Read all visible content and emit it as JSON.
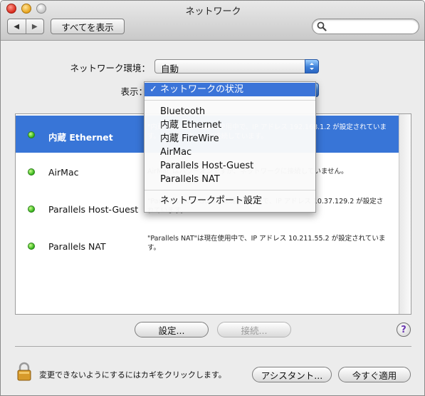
{
  "window": {
    "title": "ネットワーク"
  },
  "toolbar": {
    "back_label": "◀",
    "forward_label": "▶",
    "show_all_label": "すべてを表示",
    "search_value": ""
  },
  "location": {
    "label": "ネットワーク環境：",
    "value": "自動"
  },
  "show": {
    "label": "表示："
  },
  "dropdown": {
    "selected_check": "✓",
    "items": [
      {
        "label": "ネットワークの状況"
      },
      {
        "label": "Bluetooth"
      },
      {
        "label": "内蔵 Ethernet"
      },
      {
        "label": "内蔵 FireWire"
      },
      {
        "label": "AirMac"
      },
      {
        "label": "Parallels Host-Guest"
      },
      {
        "label": "Parallels NAT"
      },
      {
        "label": "ネットワークポート設定"
      }
    ]
  },
  "interfaces": [
    {
      "name": "内蔵 Ethernet",
      "status": "\"内蔵 Ethernet\"は現在使用中で、IP アドレス 192.168.1.2 が設定されています。インターネットに接続しています。"
    },
    {
      "name": "AirMac",
      "status": "AirMac はパワーオンですが、ネットワークに接続していません。"
    },
    {
      "name": "Parallels Host-Guest",
      "status": "\"Parallels Host-Guest\"は現在使用中で、IP アドレス 10.37.129.2 が設定されています。"
    },
    {
      "name": "Parallels NAT",
      "status": "\"Parallels NAT\"は現在使用中で、IP アドレス 10.211.55.2 が設定されています。"
    }
  ],
  "buttons": {
    "configure": "設定...",
    "connect": "接続...",
    "help": "?",
    "assistant": "アシスタント...",
    "apply_now": "今すぐ適用"
  },
  "lock": {
    "text": "変更できないようにするにはカギをクリックします。"
  }
}
